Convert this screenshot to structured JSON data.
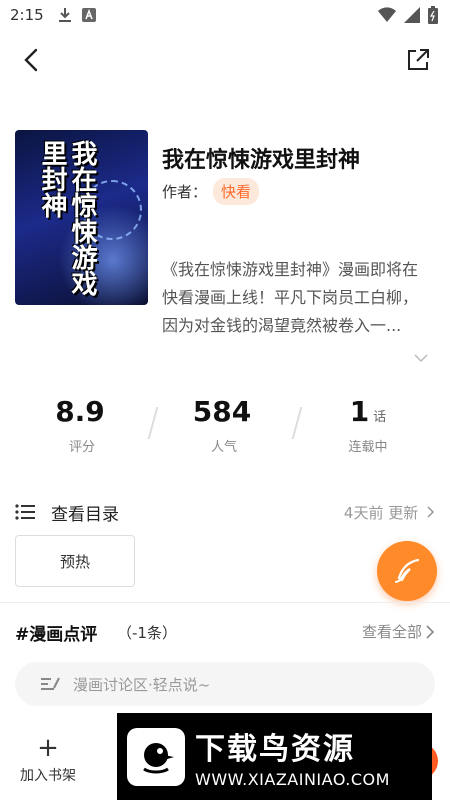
{
  "status_bar": {
    "time": "2:15",
    "icons": [
      "download-icon",
      "a-icon",
      "wifi-icon",
      "battery-icon"
    ]
  },
  "nav": {
    "back_icon": "chevron-left-icon",
    "share_icon": "share-out-icon"
  },
  "comic": {
    "title": "我在惊悚游戏里封神",
    "author_label": "作者：",
    "author": "快看",
    "cover_text": "我在惊悚游戏里封神",
    "description": "《我在惊悚游戏里封神》漫画即将在快看漫画上线！平凡下岗员工白柳，因为对金钱的渴望竟然被卷入一..."
  },
  "stats": [
    {
      "value": "8.9",
      "unit": "",
      "label": "评分"
    },
    {
      "value": "584",
      "unit": "",
      "label": "人气"
    },
    {
      "value": "1",
      "unit": "话",
      "label": "连载中"
    }
  ],
  "catalog": {
    "label": "查看目录",
    "update_info": "4天前 更新",
    "chapter_button": "预热"
  },
  "comments": {
    "title": "#漫画点评",
    "count": "（-1条）",
    "view_all": "查看全部",
    "placeholder": "漫画讨论区·轻点说~"
  },
  "bottom_bar": {
    "add_shelf_label": "加入书架"
  },
  "watermark": {
    "title": "下载鸟资源",
    "url": "WWW.XIAZAINIAO.COM"
  },
  "colors": {
    "accent": "#ff8a2a",
    "author_tag_bg": "#fde9dc",
    "author_tag_text": "#ff6a2a"
  }
}
